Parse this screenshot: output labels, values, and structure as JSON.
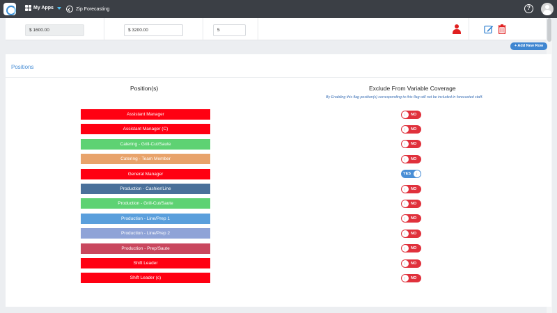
{
  "header": {
    "apps_label": "My Apps",
    "app_title": "Zip Forecasting",
    "help_glyph": "?",
    "accent_color": "#4fc0f0"
  },
  "shift_row": {
    "field1_value": "$ 1600.00",
    "field2_value": "$ 3200.00",
    "field3_value": "5",
    "icons": [
      "person-icon",
      "edit-icon",
      "delete-icon"
    ]
  },
  "add_row_button": "+ Add New Row",
  "positions_section": {
    "title": "Positions",
    "col_positions": "Position(s)",
    "col_exclude": "Exclude From Variable Coverage",
    "note": "By Enabling this flag position(s) corresponding to this flag will not be included in forecasted staff.",
    "rows": [
      {
        "name": "Assistant Manager",
        "color": "#ff0012",
        "exclude": "NO"
      },
      {
        "name": "Assistant Manager (C)",
        "color": "#ff0012",
        "exclude": "NO"
      },
      {
        "name": "Catering - Grill-Cut/Saute",
        "color": "#5ed273",
        "exclude": "NO"
      },
      {
        "name": "Catering - Team Member",
        "color": "#e8a36b",
        "exclude": "NO"
      },
      {
        "name": "General Manager",
        "color": "#ff0012",
        "exclude": "YES"
      },
      {
        "name": "Production - Cashier/Line",
        "color": "#4a709a",
        "exclude": "NO"
      },
      {
        "name": "Production - Grill-Cut/Saute",
        "color": "#5ed273",
        "exclude": "NO"
      },
      {
        "name": "Production - Line/Prep 1",
        "color": "#5a9fdc",
        "exclude": "NO"
      },
      {
        "name": "Production - Line/Prep 2",
        "color": "#8fa3d7",
        "exclude": "NO"
      },
      {
        "name": "Production - Prep/Saute",
        "color": "#c9475e",
        "exclude": "NO"
      },
      {
        "name": "Shift Leader",
        "color": "#ff0012",
        "exclude": "NO"
      },
      {
        "name": "Shift Leader (c)",
        "color": "#ff0012",
        "exclude": "NO"
      }
    ]
  }
}
